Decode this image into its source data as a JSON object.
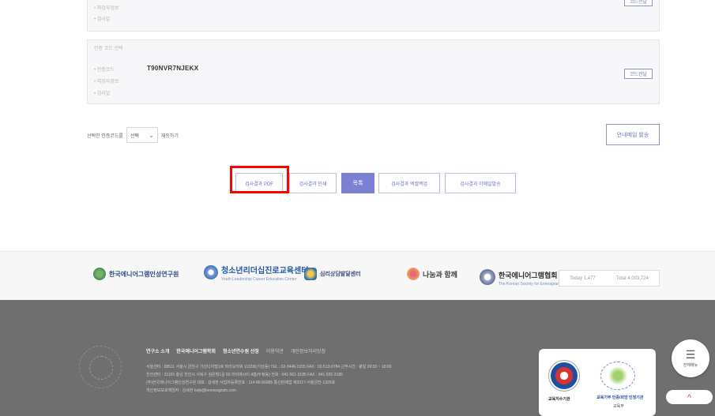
{
  "code_box_1": {
    "line1": "• 피검자정보",
    "line2": "• 검사일",
    "button": "코드전달"
  },
  "code_box_2": {
    "label": "인증 코드 선택",
    "code_label": "• 인증코드",
    "code_value": "T90NVR7NJEKX",
    "line_info": "• 피검자정보",
    "line_date": "• 검사일",
    "button": "코드전달"
  },
  "select_row": {
    "prefix": "선택한 인증코드를",
    "selected": "선택",
    "suffix": "재등하기"
  },
  "guide_button": "안내메일 발송",
  "actions": {
    "pdf": "검사결과 PDF",
    "print": "검사결과 인쇄",
    "list": "목록",
    "excel": "검사결과 엑셀백업",
    "mail": "검사결과 이메일발송"
  },
  "partners": {
    "p1": "한국에니어그램인성연구원",
    "p2": "청소년리더십진로교육센터",
    "p2_sub": "Youth Leadership Career Education Center",
    "p3": "심리상담발달센터",
    "p4": "나눔과 함께",
    "p5": "한국에니어그램협회",
    "p5_sub": "The Korean Society for Enneagram"
  },
  "counter": {
    "today": "Today 1,477",
    "total": "Total 4,003,724"
  },
  "footer": {
    "links": [
      "연구소 소개",
      "한국에니어그램학회",
      "청소년연수원 선정",
      "이용약관",
      "개인정보처리방침"
    ],
    "info": [
      "서울센터 : 08511 서울시 금천구 가산디지털1로 마리오타워 1110호(가산동)  TEL : 02-3446-3155  FAX : 02-513-0784  근무시간 : 평일 09:30 ~ 18:00",
      "천안센터 : 31165 충남 천안시 서북구 검은빛1길 60 라비에시티 4층(두정동)  전화 : 041-561-3185  FAX : 041-555-3185",
      "(주)한국에니어그램인성연구원 대표 : 김세현  사업자등록번호 : 114-86-66995  통신판매업 제2017-서울금천-1326호",
      "개인정보보호책임자 : 김세현 help@kenneagram.com"
    ]
  },
  "certs": {
    "c1": "교육지수기관",
    "c2": "교육기부 인증/희망 인정기관",
    "c3": "교육부"
  },
  "fab": {
    "icon": "menu-icon",
    "label": "전체메뉴",
    "top": "^"
  },
  "colors": {
    "accent": "#7c80d3",
    "highlight": "#ff0000",
    "footer_bg": "#6f6f70"
  }
}
